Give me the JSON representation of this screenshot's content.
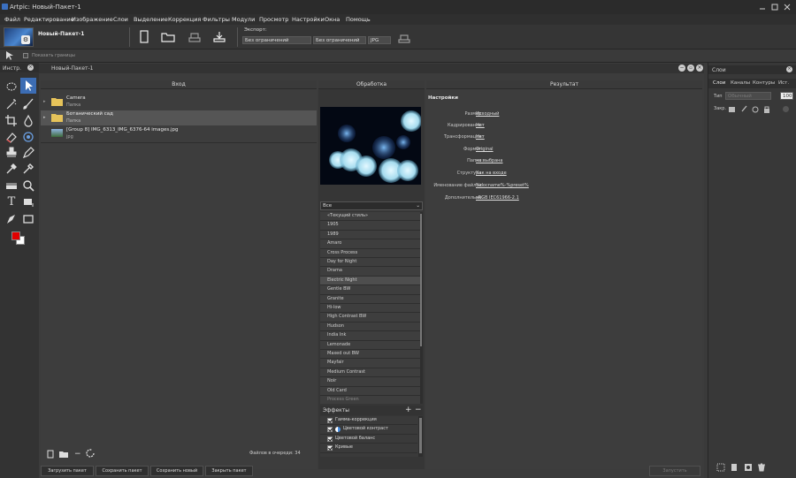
{
  "app": {
    "title": "Artpic: Новый-Пакет-1"
  },
  "menu": [
    "Файл",
    "Редактирование",
    "Изображение",
    "Слои",
    "Выделение",
    "Коррекция",
    "Фильтры",
    "Модули",
    "Просмотр",
    "Настройки",
    "Окна",
    "Помощь"
  ],
  "toolbar": {
    "doc_tab": "Новый-Пакет-1",
    "export_label": "Экспорт:",
    "export_width": "Без ограничений",
    "export_height": "Без ограничений",
    "export_format": "JPG",
    "show_borders": "Показать границы"
  },
  "tools_panel": {
    "title": "Инстр.",
    "fg_color": "#e00000",
    "bg_color": "#ffffff"
  },
  "batch": {
    "title": "Новый-Пакет-1",
    "input_header": "Вход",
    "processing_header": "Обработка",
    "result_header": "Результат",
    "files": [
      {
        "name": "Camera",
        "sub": "Папка"
      },
      {
        "name": "Ботанический сад",
        "sub": "Папка"
      },
      {
        "name": "[Group 8] IMG_6313_IMG_6376-64 images.jpg",
        "sub": "jpg"
      }
    ],
    "queue_text": "Файлов в очереди: 34",
    "buttons": {
      "load": "Загрузить пакет",
      "save": "Сохранить пакет",
      "save_new": "Сохранить новый",
      "close": "Закрыть пакет",
      "start": "Запустить"
    },
    "preset_filter": "Все",
    "presets": [
      "«Текущий стиль»",
      "1905",
      "1989",
      "Amaro",
      "Cross Process",
      "Day for Night",
      "Drama",
      "Electric Night",
      "Gentle BW",
      "Granite",
      "Hi-low",
      "High Contrast BW",
      "Hudson",
      "India Ink",
      "Lemonade",
      "Maxed out BW",
      "Mayfair",
      "Medium Contrast",
      "Noir",
      "Old Card",
      "Process Green"
    ],
    "selected_preset": "Electric Night",
    "effects_header": "Эффекты",
    "effects": [
      "Гамма-коррекция",
      "Цветовой контраст",
      "Цветовой баланс",
      "Кривые"
    ],
    "settings_header": "Настройки",
    "settings": [
      {
        "label": "Размер:",
        "value": "Исходный"
      },
      {
        "label": "Кадрирование:",
        "value": "Нет"
      },
      {
        "label": "Трансформация:",
        "value": "Нет"
      },
      {
        "label": "Формат:",
        "value": "Original"
      },
      {
        "label": "Папка:",
        "value": "не выбрана"
      },
      {
        "label": "Структура:",
        "value": "Как на входе"
      },
      {
        "label": "Именование файлов:",
        "value": "%docname%-%preset%"
      },
      {
        "label": "Дополнительно:",
        "value": "sRGB IEC61966-2.1"
      }
    ]
  },
  "layers": {
    "title": "Слои",
    "tabs": [
      "Слои",
      "Каналы",
      "Контуры",
      "Ист."
    ],
    "type_label": "Тип",
    "blend_mode": "Обычный",
    "opacity": "100",
    "lock_label": "Закр."
  }
}
